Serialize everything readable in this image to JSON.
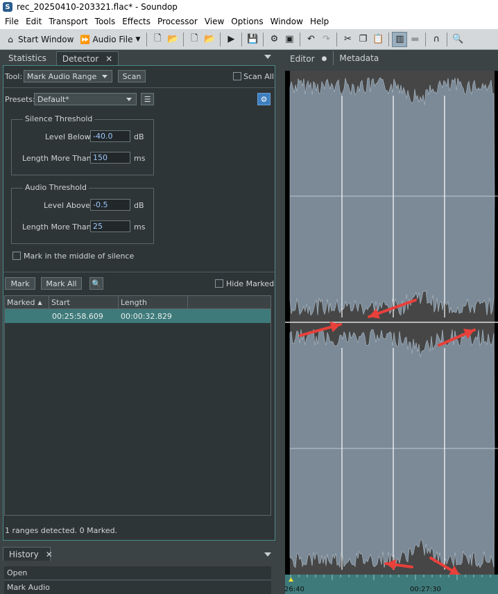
{
  "window": {
    "title": "rec_20250410-203321.flac* - Soundop",
    "app_icon": "S"
  },
  "menu": [
    "File",
    "Edit",
    "Transport",
    "Tools",
    "Effects",
    "Processor",
    "View",
    "Options",
    "Window",
    "Help"
  ],
  "toolbar": {
    "start_window": "Start Window",
    "audio_file": "Audio File"
  },
  "left_tabs": {
    "statistics": "Statistics",
    "detector": "Detector",
    "close": "✕"
  },
  "detector": {
    "tool_label": "Tool:",
    "tool_value": "Mark Audio Range",
    "scan_label": "Scan",
    "scan_all_label": "Scan All",
    "presets_label": "Presets:",
    "presets_value": "Default*",
    "silence": {
      "title": "Silence Threshold",
      "level_label": "Level Below:",
      "level_value": "-40.0",
      "level_unit": "dB",
      "length_label": "Length More Than:",
      "length_value": "150",
      "length_unit": "ms"
    },
    "audio": {
      "title": "Audio Threshold",
      "level_label": "Level Above:",
      "level_value": "-0.5",
      "level_unit": "dB",
      "length_label": "Length More Than:",
      "length_value": "25",
      "length_unit": "ms"
    },
    "middle_label": "Mark in the middle of silence",
    "mark_label": "Mark",
    "mark_all_label": "Mark All",
    "hide_marked_label": "Hide Marked",
    "columns": {
      "marked": "Marked",
      "start": "Start",
      "length": "Length"
    },
    "rows": [
      {
        "start": "00:25:58.609",
        "length": "00:00:32.829"
      }
    ],
    "status": "1 ranges detected. 0 Marked."
  },
  "history": {
    "tab": "History",
    "items": [
      "Open",
      "Mark Audio"
    ]
  },
  "editor_tabs": {
    "editor": "Editor",
    "metadata": "Metadata"
  },
  "ruler": {
    "left_label": "26:40",
    "mid_label": "00:27:30"
  },
  "colors": {
    "accent": "#3f7a7a",
    "wave": "#8fa1b3",
    "arrow": "#e8403a"
  }
}
